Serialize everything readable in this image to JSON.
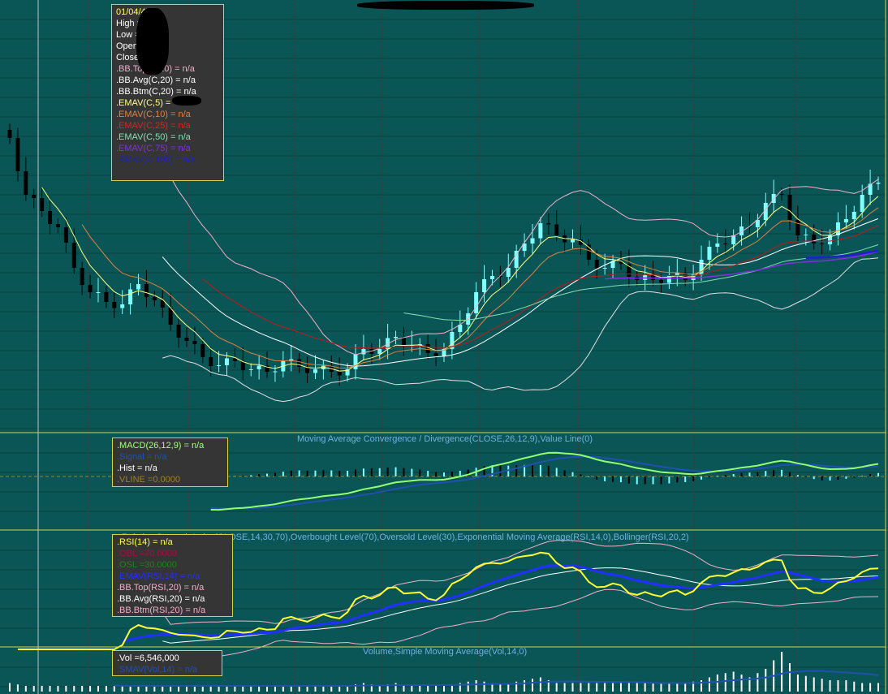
{
  "colors": {
    "background": "#0a5656",
    "grid_h": "#0b4242",
    "grid_v": "#5a2e2e",
    "border": "#d8d040",
    "up": "#7fffff",
    "down": "#000000"
  },
  "main_legend": {
    "date": "01/04/47",
    "rows": [
      {
        "label": "High  =",
        "color": "#ffffff"
      },
      {
        "label": "Low   =",
        "color": "#ffffff"
      },
      {
        "label": "Open  =",
        "color": "#ffffff"
      },
      {
        "label": "Close =",
        "color": "#ffffff"
      },
      {
        "label": ".BB.Top(C,20)   = n/a",
        "color": "#f0b0c8"
      },
      {
        "label": ".BB.Avg(C,20)   = n/a",
        "color": "#ffffff"
      },
      {
        "label": ".BB.Btm(C,20)   = n/a",
        "color": "#ffffff"
      },
      {
        "label": ".EMAV(C,5)   =",
        "color": "#ffff80"
      },
      {
        "label": ".EMAV(C,10)   = n/a",
        "color": "#e08040"
      },
      {
        "label": ".EMAV(C,25)   = n/a",
        "color": "#e02020"
      },
      {
        "label": ".EMAV(C,50)   = n/a",
        "color": "#80e0b0"
      },
      {
        "label": ".EMAV(C,75)   = n/a",
        "color": "#8030e0"
      },
      {
        "label": ".EMAV(C,100)   = n/a",
        "color": "#2020c0"
      }
    ]
  },
  "macd": {
    "title": "Moving Average Convergence / Divergence(CLOSE,26,12,9),Value Line(0)",
    "rows": [
      {
        "label": ".MACD(26,12,9)   = n/a",
        "color": "#a0ff80"
      },
      {
        "label": ".Signal = n/a",
        "color": "#2050b0"
      },
      {
        "label": ".Hist  = n/a",
        "color": "#ffffff"
      },
      {
        "label": ".VLINE   =0.0000",
        "color": "#a08020"
      }
    ]
  },
  "rsi": {
    "title": "Relative Strength Index(CLOSE,14,30,70),Overbought Level(70),Oversold Level(30),Exponential Moving Average(RSI,14,0),Bollinger(RSI,20,2)",
    "rows": [
      {
        "label": ".RSI(14)   = n/a",
        "color": "#ffff40"
      },
      {
        "label": ".OBL   =70.0000",
        "color": "#a01040"
      },
      {
        "label": ".OSL   =30.0000",
        "color": "#208020"
      },
      {
        "label": ".EMAV(RSI,14)   = n/a",
        "color": "#2030ff"
      },
      {
        "label": ".BB.Top(RSI,20)   = n/a",
        "color": "#f0b0c8"
      },
      {
        "label": ".BB.Avg(RSI,20)   = n/a",
        "color": "#ffffff"
      },
      {
        "label": ".BB.Btm(RSI,20)   = n/a",
        "color": "#f0b0c8"
      }
    ]
  },
  "volume": {
    "title": "Volume,Simple Moving Average(Vol,14,0)",
    "rows": [
      {
        "label": ".Vol   =6,546,000",
        "color": "#ffffff"
      },
      {
        "label": ".SMAV(Vol,14)   = n/a",
        "color": "#2050b0"
      }
    ]
  },
  "chart_data": {
    "type": "candlestick",
    "title": "",
    "closes": [
      72,
      58,
      54,
      50,
      40,
      34,
      31.6,
      31,
      36,
      32,
      26,
      22,
      18,
      16,
      17,
      15,
      14.4,
      17,
      15.6,
      15,
      14.4,
      15,
      20,
      20,
      23,
      21,
      19,
      20,
      26,
      34,
      38,
      40,
      46,
      51,
      48,
      47,
      42,
      40,
      41,
      37,
      37,
      38,
      37,
      42,
      46,
      48,
      50,
      56,
      58,
      48,
      46,
      48,
      52,
      58,
      61
    ],
    "volumes": [
      3,
      2,
      2,
      2,
      2,
      2,
      2,
      2,
      2,
      2,
      2,
      2,
      2,
      2,
      2,
      2,
      2,
      2,
      2,
      2,
      2,
      2,
      3,
      2,
      3,
      2,
      2,
      2,
      3,
      4,
      3,
      3,
      4,
      5,
      3,
      3,
      3,
      3,
      3,
      3,
      3,
      3,
      3,
      4,
      6,
      7,
      5,
      8,
      14,
      6,
      5,
      4,
      4,
      3,
      3
    ],
    "rsi_levels": [
      30,
      70
    ]
  }
}
